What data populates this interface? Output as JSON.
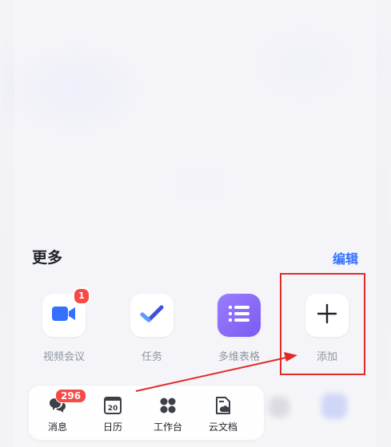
{
  "section": {
    "title": "更多",
    "edit_label": "编辑"
  },
  "apps": [
    {
      "label": "视频会议",
      "icon": "video-camera-icon",
      "badge": "1"
    },
    {
      "label": "任务",
      "icon": "checkmark-icon"
    },
    {
      "label": "多维表格",
      "icon": "list-icon"
    },
    {
      "label": "添加",
      "icon": "plus-icon"
    }
  ],
  "tabbar": {
    "items": [
      {
        "label": "消息",
        "icon": "chat-bubbles-icon",
        "badge": "296"
      },
      {
        "label": "日历",
        "icon": "calendar-icon",
        "icon_text": "20"
      },
      {
        "label": "工作台",
        "icon": "workspace-grid-icon"
      },
      {
        "label": "云文档",
        "icon": "cloud-doc-icon"
      }
    ]
  },
  "colors": {
    "accent": "#3370ff",
    "badge": "#f54a45",
    "highlight": "#e12b28",
    "purple": "#8b6cf7"
  }
}
